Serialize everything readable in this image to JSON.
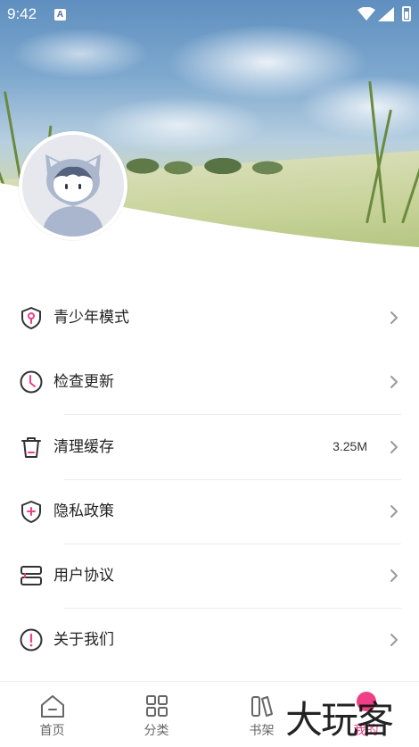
{
  "status_bar": {
    "time": "9:42",
    "notification_badge": "A",
    "icons": [
      "wifi-icon",
      "signal-icon",
      "battery-icon"
    ]
  },
  "profile": {
    "avatar_icon": "avatar-cat-hood-icon"
  },
  "menu": {
    "items": [
      {
        "label": "青少年模式",
        "icon": "shield-key-icon",
        "value": ""
      },
      {
        "label": "检查更新",
        "icon": "clock-icon",
        "value": ""
      },
      {
        "label": "清理缓存",
        "icon": "trash-icon",
        "value": "3.25M"
      },
      {
        "label": "隐私政策",
        "icon": "shield-plus-icon",
        "value": ""
      },
      {
        "label": "用户协议",
        "icon": "document-stack-icon",
        "value": ""
      },
      {
        "label": "关于我们",
        "icon": "info-exclamation-icon",
        "value": ""
      }
    ]
  },
  "bottom_nav": {
    "items": [
      {
        "label": "首页",
        "icon": "home-icon",
        "active": false
      },
      {
        "label": "分类",
        "icon": "grid-icon",
        "active": false
      },
      {
        "label": "书架",
        "icon": "books-icon",
        "active": false
      },
      {
        "label": "我的",
        "icon": "profile-icon",
        "active": true
      }
    ]
  },
  "watermark": "大玩客",
  "colors": {
    "accent": "#ef3f86",
    "icon_stroke": "#333333",
    "divider": "#ececec",
    "text_primary": "#222222",
    "nav_inactive": "#666666"
  }
}
